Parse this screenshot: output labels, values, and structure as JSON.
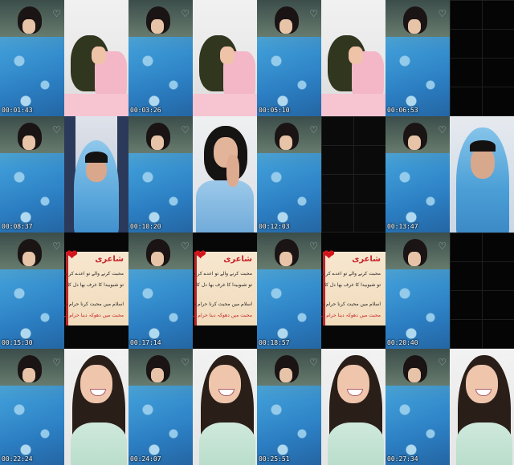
{
  "tiles": [
    {
      "row": 0,
      "col": 0,
      "kind": "blue-girl",
      "timestamp": "00:01:43"
    },
    {
      "row": 0,
      "col": 1,
      "kind": "pink-girl",
      "timestamp": ""
    },
    {
      "row": 0,
      "col": 2,
      "kind": "blue-girl",
      "timestamp": "00:03:26"
    },
    {
      "row": 0,
      "col": 3,
      "kind": "pink-girl",
      "timestamp": ""
    },
    {
      "row": 0,
      "col": 4,
      "kind": "blue-girl",
      "timestamp": "00:05:10"
    },
    {
      "row": 0,
      "col": 5,
      "kind": "pink-girl",
      "timestamp": ""
    },
    {
      "row": 0,
      "col": 6,
      "kind": "blue-girl",
      "timestamp": "00:06:53"
    },
    {
      "row": 0,
      "col": 7,
      "kind": "dark-grid",
      "timestamp": ""
    },
    {
      "row": 1,
      "col": 0,
      "kind": "blue-girl",
      "timestamp": "00:08:37"
    },
    {
      "row": 1,
      "col": 1,
      "kind": "hijab-girl",
      "timestamp": ""
    },
    {
      "row": 1,
      "col": 2,
      "kind": "blue-girl",
      "timestamp": "00:10:20"
    },
    {
      "row": 1,
      "col": 3,
      "kind": "cry-girl",
      "timestamp": ""
    },
    {
      "row": 1,
      "col": 4,
      "kind": "blue-girl",
      "timestamp": "00:12:03"
    },
    {
      "row": 1,
      "col": 5,
      "kind": "dark-grid-2",
      "timestamp": ""
    },
    {
      "row": 1,
      "col": 6,
      "kind": "blue-girl",
      "timestamp": "00:13:47"
    },
    {
      "row": 1,
      "col": 7,
      "kind": "hijab2",
      "timestamp": ""
    },
    {
      "row": 2,
      "col": 0,
      "kind": "blue-girl",
      "timestamp": "00:15:30"
    },
    {
      "row": 2,
      "col": 1,
      "kind": "poetry",
      "timestamp": ""
    },
    {
      "row": 2,
      "col": 2,
      "kind": "blue-girl",
      "timestamp": "00:17:14"
    },
    {
      "row": 2,
      "col": 3,
      "kind": "poetry",
      "timestamp": ""
    },
    {
      "row": 2,
      "col": 4,
      "kind": "blue-girl",
      "timestamp": "00:18:57"
    },
    {
      "row": 2,
      "col": 5,
      "kind": "poetry",
      "timestamp": ""
    },
    {
      "row": 2,
      "col": 6,
      "kind": "blue-girl",
      "timestamp": "00:20:40"
    },
    {
      "row": 2,
      "col": 7,
      "kind": "dark-grid",
      "timestamp": ""
    },
    {
      "row": 3,
      "col": 0,
      "kind": "blue-girl",
      "timestamp": "00:22:24"
    },
    {
      "row": 3,
      "col": 1,
      "kind": "smile-girl",
      "timestamp": ""
    },
    {
      "row": 3,
      "col": 2,
      "kind": "blue-girl",
      "timestamp": "00:24:07"
    },
    {
      "row": 3,
      "col": 3,
      "kind": "smile-girl",
      "timestamp": ""
    },
    {
      "row": 3,
      "col": 4,
      "kind": "blue-girl",
      "timestamp": "00:25:51"
    },
    {
      "row": 3,
      "col": 5,
      "kind": "smile-girl",
      "timestamp": ""
    },
    {
      "row": 3,
      "col": 6,
      "kind": "blue-girl",
      "timestamp": "00:27:34"
    },
    {
      "row": 3,
      "col": 7,
      "kind": "smile-girl",
      "timestamp": ""
    }
  ],
  "poetry_card": {
    "title": "شاعری",
    "lines": [
      "محبت کرنے والے تو اعدے کر شامل",
      "تو شبوبیدا کا غرف بھا دل کا",
      "اسلام میں محبت کرنا حرام نہیں ہے",
      "محبت میں دھوکہ دینا حرام ہے"
    ]
  },
  "icons": {
    "heart": "heart-icon",
    "floating_hearts": "floating-hearts-icon"
  }
}
